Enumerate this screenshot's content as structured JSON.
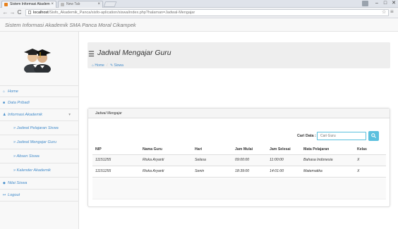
{
  "browser": {
    "tabs": [
      {
        "title": "Sistem Informasi Akadem"
      },
      {
        "title": "New Tab"
      }
    ],
    "url_host": "localhost",
    "url_path": "/Sisfo_Akademik_Panca/sisfo-aplication/siswa/index.php?halaman=Jadwal-Mengajar"
  },
  "app": {
    "title": "Sistem Informasi Akademik SMA Panca Moral Cikampek"
  },
  "sidebar": {
    "items": [
      {
        "label": "Home",
        "icon": "home-icon"
      },
      {
        "label": "Data Pribadi",
        "icon": "user-icon"
      },
      {
        "label": "Informasi Akademik",
        "icon": "people-icon"
      },
      {
        "label": "» Jadwal Pelajaran Siswa"
      },
      {
        "label": "» Jadwal Mengajar Guru"
      },
      {
        "label": "» Absen Siswa"
      },
      {
        "label": "» Kalender Akademik"
      },
      {
        "label": "Nilai Siswa",
        "icon": "pin-icon"
      },
      {
        "label": "Logout",
        "icon": "logout-icon"
      }
    ]
  },
  "page": {
    "title": "Jadwal Mengajar Guru",
    "breadcrumb": [
      "Home",
      "Siswa"
    ]
  },
  "panel": {
    "heading": "Jadwal Mengajar",
    "search_label": "Cari Data :",
    "search_placeholder": "Cari Guru",
    "columns": [
      "NIP",
      "Nama Guru",
      "Hari",
      "Jam Mulai",
      "Jam Selesai",
      "Mata Pelajaran",
      "Kelas"
    ],
    "rows": [
      [
        "11151255",
        "Riska Aryanti",
        "Selasa",
        "09:00:00",
        "11:00:00",
        "Bahasa Indonesia",
        "X"
      ],
      [
        "11151255",
        "Riska Aryanti",
        "Senin",
        "18:39:00",
        "14:01:00",
        "Matematika",
        "X"
      ]
    ]
  },
  "colors": {
    "link": "#428bca",
    "search_button": "#5bc0de"
  }
}
